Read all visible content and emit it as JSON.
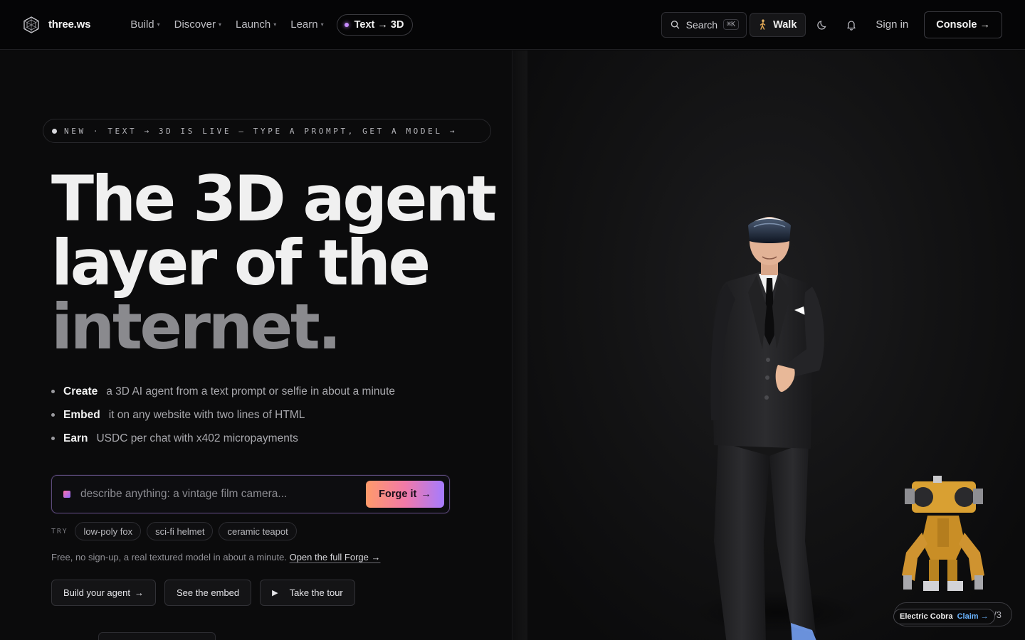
{
  "nav": {
    "brand": "three.ws",
    "links": [
      {
        "label": "Build",
        "caret": "▾"
      },
      {
        "label": "Discover",
        "caret": "▾"
      },
      {
        "label": "Launch",
        "caret": "▾"
      },
      {
        "label": "Learn",
        "caret": "▾"
      }
    ],
    "feature_pill": "Text → 3D",
    "search_label": "Search",
    "search_shortcut": "⌘K",
    "walk_label": "Walk",
    "signin_label": "Sign in",
    "console_label": "Console →",
    "icons": [
      "logo-icon",
      "search-icon",
      "walking-person-icon",
      "moon-icon",
      "bell-icon"
    ]
  },
  "hero": {
    "announcement": "NEW · TEXT → 3D IS LIVE — TYPE A PROMPT, GET A MODEL →",
    "headline_line1": "The 3D agent",
    "headline_line2": "layer of the",
    "headline_line3": "internet.",
    "bullets": [
      {
        "term": "Create",
        "text": "a 3D AI agent from a text prompt or selfie in about a minute"
      },
      {
        "term": "Embed",
        "text": "it on any website with two lines of HTML"
      },
      {
        "term": "Earn",
        "text": "USDC per chat with x402 micropayments"
      }
    ],
    "forge": {
      "placeholder": "describe anything: a vintage film camera...",
      "value": "",
      "button_label": "Forge it",
      "button_arrow": "→"
    },
    "try": {
      "label": "TRY",
      "chips": [
        "low-poly fox",
        "sci-fi helmet",
        "ceramic teapot"
      ]
    },
    "free_note": "Free, no sign-up, a real textured model in about a minute.",
    "free_link": "Open the full Forge →",
    "ctas": [
      {
        "label": "Build your agent",
        "suffix": "→"
      },
      {
        "label": "See the embed",
        "suffix": ""
      },
      {
        "label": "Take the tour",
        "prefix": "▶"
      }
    ]
  },
  "stage": {
    "badge_name": "Electric Cobra",
    "badge_claim": "Claim →",
    "badge_count": "0/3"
  },
  "colors": {
    "background": "#0a0a0b",
    "accent_gradient_start": "#ff9a6a",
    "accent_gradient_end": "#a57bff",
    "claim_link": "#6ab4ff"
  }
}
